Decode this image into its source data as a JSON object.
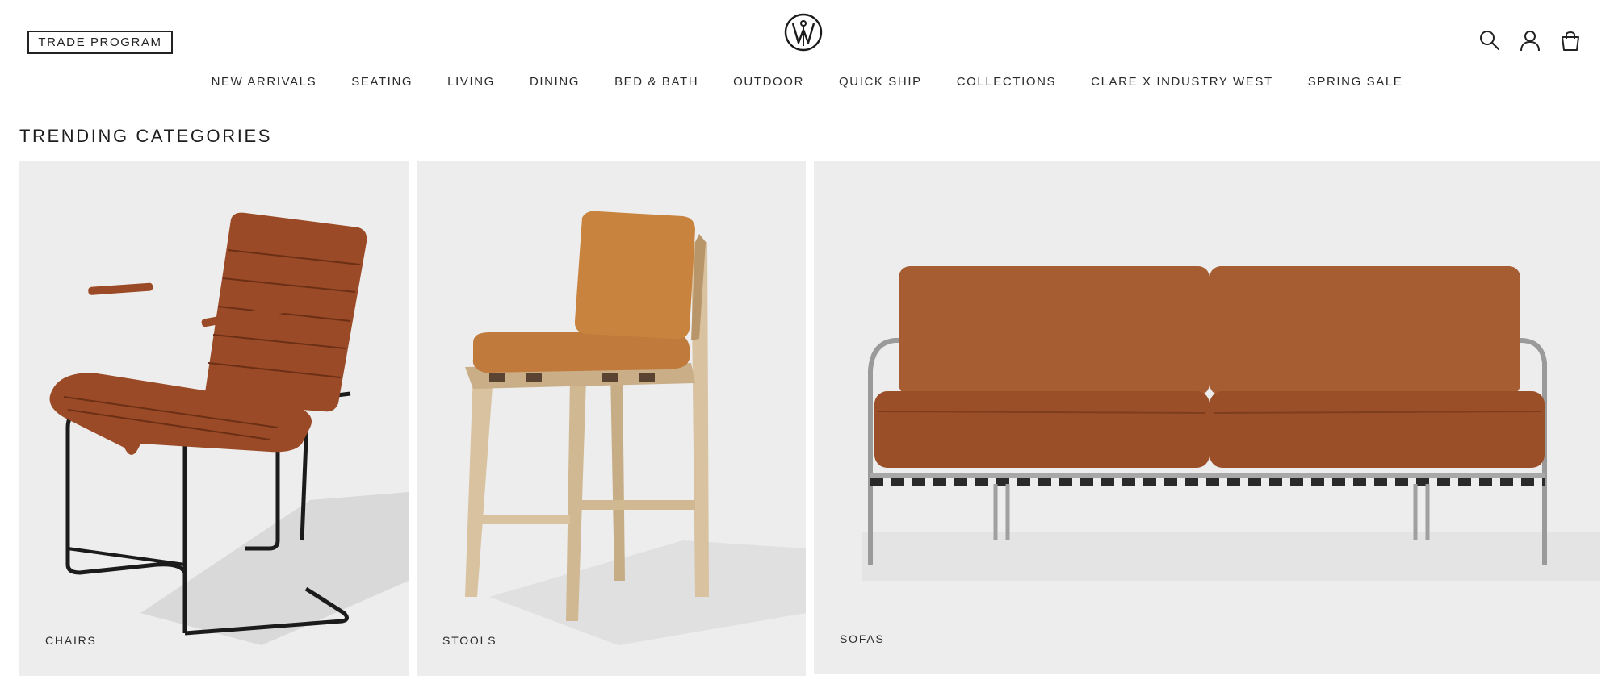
{
  "header": {
    "trade_button": "TRADE PROGRAM",
    "logo_icon": "industry-west-w-logo",
    "icons": [
      "search-icon",
      "account-icon",
      "shopping-bag-icon"
    ]
  },
  "nav": {
    "items": [
      {
        "label": "NEW ARRIVALS"
      },
      {
        "label": "SEATING"
      },
      {
        "label": "LIVING"
      },
      {
        "label": "DINING"
      },
      {
        "label": "BED & BATH"
      },
      {
        "label": "OUTDOOR"
      },
      {
        "label": "QUICK SHIP"
      },
      {
        "label": "COLLECTIONS"
      },
      {
        "label": "CLARE X INDUSTRY WEST"
      },
      {
        "label": "SPRING SALE"
      }
    ]
  },
  "trending": {
    "title": "TRENDING CATEGORIES",
    "cards": [
      {
        "label": "CHAIRS"
      },
      {
        "label": "STOOLS"
      },
      {
        "label": "SOFAS"
      }
    ]
  },
  "colors": {
    "card_background": "#ededed",
    "leather": "#9a4a26",
    "leather_tan": "#c07a3c",
    "wood": "#d8c2a0",
    "frame_black": "#1b1b1b"
  }
}
